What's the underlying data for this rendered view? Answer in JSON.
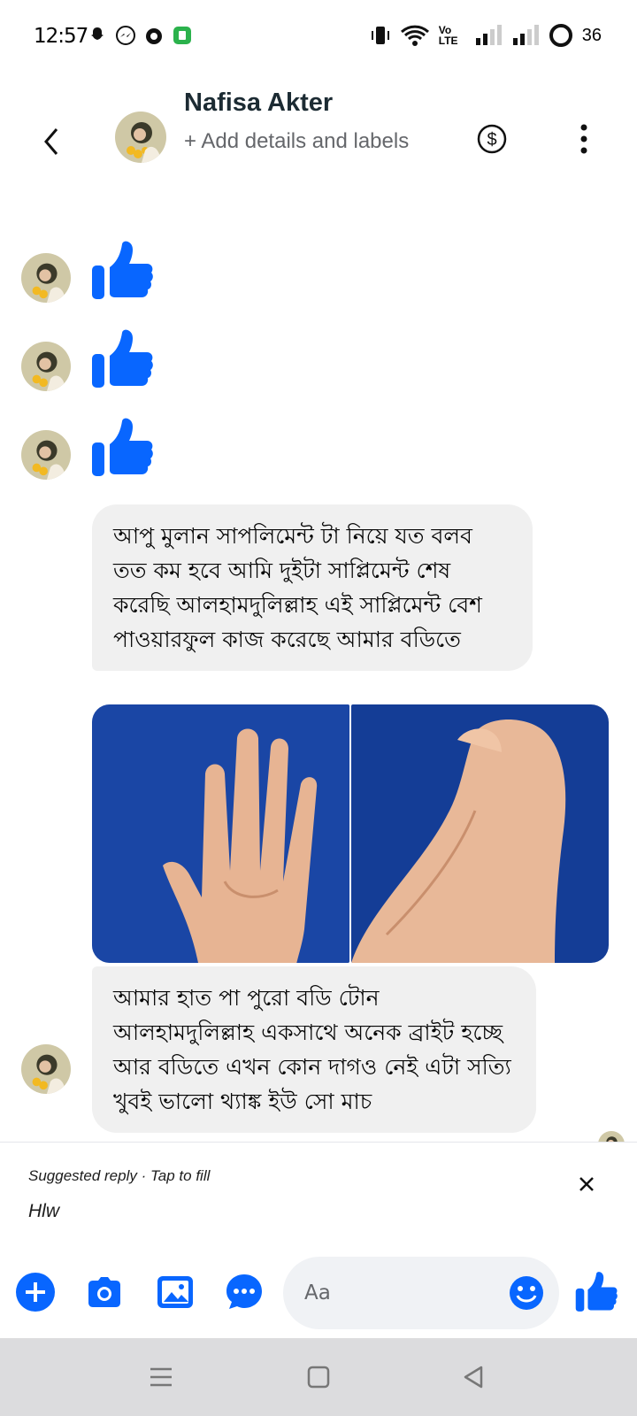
{
  "status_bar": {
    "time": "12:57",
    "network": "Vo LTE",
    "battery": "36"
  },
  "header": {
    "contact_name": "Nafisa Akter",
    "subtitle": "+ Add details and labels"
  },
  "messages": [
    {
      "type": "like"
    },
    {
      "type": "like"
    },
    {
      "type": "like"
    },
    {
      "type": "text",
      "text": "আপু মুলান সাপলিমেন্ট টা নিয়ে যত বলব তত কম হবে আমি দুইটা সাপ্লিমেন্ট শেষ করেছি আলহামদুলিল্লাহ এই সাপ্লিমেন্ট বেশ পাওয়ারফুল কাজ করেছে আমার বডিতে"
    },
    {
      "type": "photos",
      "items": [
        "hand-photo",
        "foot-photo"
      ]
    },
    {
      "type": "text",
      "text": "আমার হাত পা পুরো বডি টোন আলহামদুলিল্লাহ একসাথে অনেক ব্রাইট হচ্ছে আর বডিতে এখন কোন দাগও নেই এটা সত্যি খুবই ভালো থ্যাঙ্ক ইউ সো মাচ"
    }
  ],
  "suggested_reply": {
    "label": "Suggested reply · Tap to fill",
    "text": "Hlw"
  },
  "composer": {
    "placeholder": "Aa"
  },
  "colors": {
    "accent": "#0866ff",
    "bubble_bg": "#f0f0f0",
    "nav_bg": "#dcdcde"
  }
}
